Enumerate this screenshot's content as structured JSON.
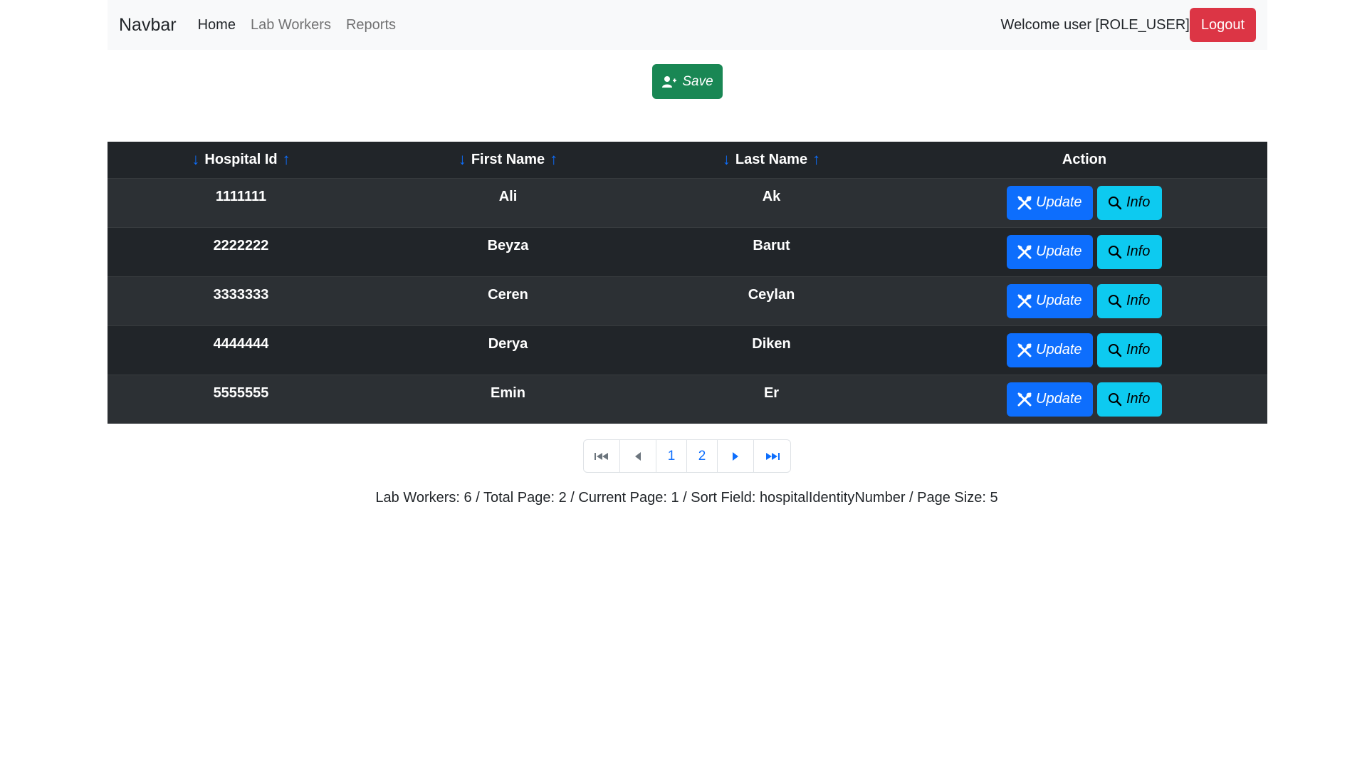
{
  "navbar": {
    "brand": "Navbar",
    "links": [
      {
        "label": "Home"
      },
      {
        "label": "Lab Workers"
      },
      {
        "label": "Reports"
      }
    ],
    "welcome": "Welcome user [ROLE_USER]",
    "logout_label": "Logout"
  },
  "save_label": "Save",
  "table": {
    "headers": [
      "Hospital Id",
      "First Name",
      "Last Name",
      "Action"
    ],
    "rows": [
      {
        "hospital_id": "1111111",
        "first_name": "Ali",
        "last_name": "Ak"
      },
      {
        "hospital_id": "2222222",
        "first_name": "Beyza",
        "last_name": "Barut"
      },
      {
        "hospital_id": "3333333",
        "first_name": "Ceren",
        "last_name": "Ceylan"
      },
      {
        "hospital_id": "4444444",
        "first_name": "Derya",
        "last_name": "Diken"
      },
      {
        "hospital_id": "5555555",
        "first_name": "Emin",
        "last_name": "Er"
      }
    ],
    "update_label": "Update",
    "info_label": "Info"
  },
  "pagination": {
    "pages": [
      "1",
      "2"
    ]
  },
  "summary": "Lab Workers: 6 / Total Page: 2 / Current Page: 1 / Sort Field: hospitalIdentityNumber / Page Size: 5",
  "colors": {
    "primary": "#0d6efd",
    "success": "#198754",
    "danger": "#dc3545",
    "info": "#0dcaf0",
    "dark": "#212529"
  },
  "icons": {
    "save": "person-plus-icon",
    "update": "tools-icon",
    "info": "search-icon",
    "first": "skip-start-icon",
    "prev": "caret-left-icon",
    "next": "caret-right-icon",
    "last": "skip-end-icon",
    "sort_desc": "arrow-down-icon",
    "sort_asc": "arrow-up-icon"
  }
}
